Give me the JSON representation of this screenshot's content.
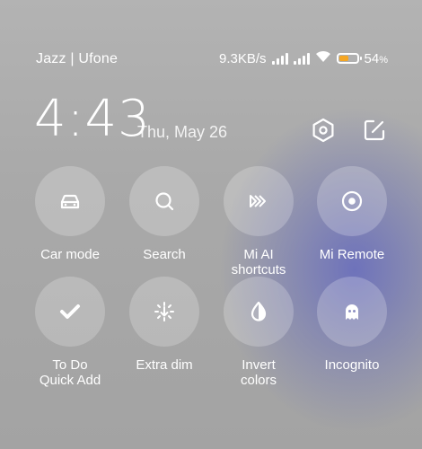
{
  "status_bar": {
    "carrier": "Jazz | Ufone",
    "network_speed": "9.3KB/s",
    "battery_percent": "54",
    "battery_unit": "%",
    "battery_level": 0.54,
    "battery_color": "#f4a623"
  },
  "header": {
    "time": "4:43",
    "date": "Thu, May 26",
    "settings_icon": "hexagon-gear-icon",
    "edit_icon": "edit-icon"
  },
  "tiles": [
    {
      "label": "Car mode",
      "icon": "car-icon"
    },
    {
      "label": "Search",
      "icon": "search-icon"
    },
    {
      "label": "Mi AI\nshortcuts",
      "icon": "shortcuts-icon"
    },
    {
      "label": "Mi Remote",
      "icon": "remote-icon"
    },
    {
      "label": "To Do\nQuick Add",
      "icon": "checkmark-icon"
    },
    {
      "label": "Extra dim",
      "icon": "extra-dim-icon"
    },
    {
      "label": "Invert\ncolors",
      "icon": "invert-colors-icon"
    },
    {
      "label": "Incognito",
      "icon": "ghost-icon"
    }
  ]
}
